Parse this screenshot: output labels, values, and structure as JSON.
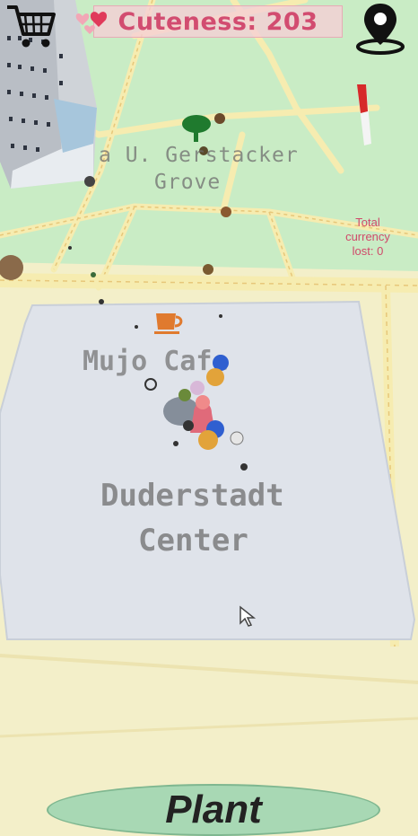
{
  "hud": {
    "cuteness_text": "Cuteness: 203",
    "currency_line1": "Total",
    "currency_line2": "currency",
    "currency_line3": "lost: 0"
  },
  "map": {
    "grove_label_line1": "a U. Gerstacker",
    "grove_label_line2": "Grove",
    "cafe_label": "Mujo Cafe",
    "center_label_line1": "Duderstadt",
    "center_label_line2": "Center"
  },
  "actions": {
    "plant_label": "Plant"
  },
  "icons": {
    "cart": "shopping-cart-icon",
    "location": "location-pin-icon",
    "hearts": "hearts-icon",
    "cafe": "coffee-cup-icon",
    "cursor": "mouse-pointer-icon"
  },
  "colors": {
    "park_green": "#c9ecc5",
    "plaza": "#dfe3ea",
    "road_yellow": "#f2e8a0",
    "cuteness_text": "#d24c70",
    "plant_button": "#a8d8b4"
  }
}
